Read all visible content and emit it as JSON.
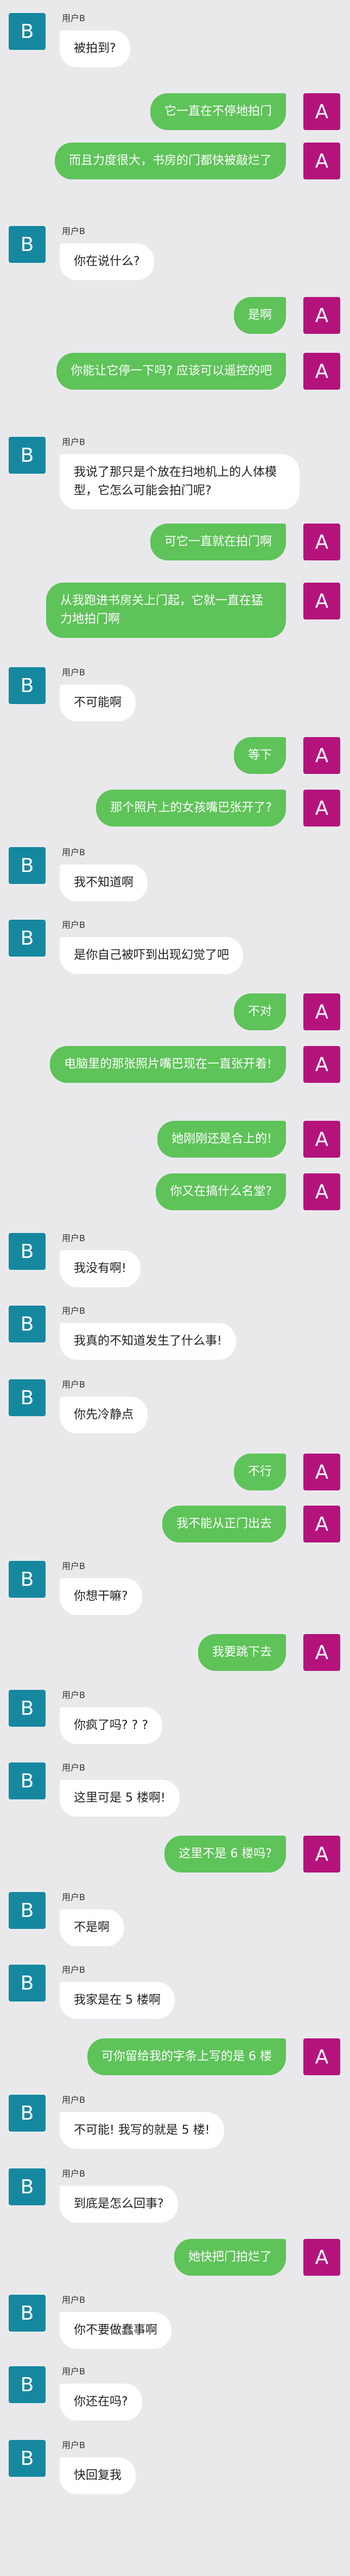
{
  "users": {
    "b_avatar_letter": "B",
    "a_avatar_letter": "A",
    "b_name": "用户B"
  },
  "colors": {
    "background": "#e9e9ec",
    "b_avatar": "#1588a0",
    "a_avatar": "#b5137c",
    "a_bubble": "#5ec359",
    "b_bubble": "#ffffff"
  },
  "messages": [
    {
      "from": "b",
      "text": "被拍到?"
    },
    {
      "from": "a",
      "text": "它一直在不停地拍门"
    },
    {
      "from": "a",
      "text": "而且力度很大，书房的门都快被敲烂了"
    },
    {
      "from": "b",
      "text": "你在说什么?"
    },
    {
      "from": "a",
      "text": "是啊"
    },
    {
      "from": "a",
      "text": "你能让它停一下吗? 应该可以遥控的吧"
    },
    {
      "from": "b",
      "text": "我说了那只是个放在扫地机上的人体模型，它怎么可能会拍门呢?"
    },
    {
      "from": "a",
      "text": "可它一直就在拍门啊"
    },
    {
      "from": "a",
      "text": "从我跑进书房关上门起，它就一直在猛力地拍门啊"
    },
    {
      "from": "b",
      "text": "不可能啊"
    },
    {
      "from": "a",
      "text": "等下"
    },
    {
      "from": "a",
      "text": "那个照片上的女孩嘴巴张开了?"
    },
    {
      "from": "b",
      "text": "我不知道啊"
    },
    {
      "from": "b",
      "text": "是你自己被吓到出现幻觉了吧"
    },
    {
      "from": "a",
      "text": "不对"
    },
    {
      "from": "a",
      "text": "电脑里的那张照片嘴巴现在一直张开着!"
    },
    {
      "from": "a",
      "text": "她刚刚还是合上的!"
    },
    {
      "from": "a",
      "text": "你又在搞什么名堂?"
    },
    {
      "from": "b",
      "text": "我没有啊!"
    },
    {
      "from": "b",
      "text": "我真的不知道发生了什么事!"
    },
    {
      "from": "b",
      "text": "你先冷静点"
    },
    {
      "from": "a",
      "text": "不行"
    },
    {
      "from": "a",
      "text": "我不能从正门出去"
    },
    {
      "from": "b",
      "text": "你想干嘛?"
    },
    {
      "from": "a",
      "text": "我要跳下去"
    },
    {
      "from": "b",
      "text": "你疯了吗? ? ?"
    },
    {
      "from": "b",
      "text": "这里可是 5 楼啊!"
    },
    {
      "from": "a",
      "text": "这里不是 6 楼吗?"
    },
    {
      "from": "b",
      "text": "不是啊"
    },
    {
      "from": "b",
      "text": "我家是在 5 楼啊"
    },
    {
      "from": "a",
      "text": "可你留给我的字条上写的是 6 楼"
    },
    {
      "from": "b",
      "text": "不可能! 我写的就是 5 楼!"
    },
    {
      "from": "b",
      "text": "到底是怎么回事?"
    },
    {
      "from": "a",
      "text": "她快把门拍烂了"
    },
    {
      "from": "b",
      "text": "你不要做蠢事啊"
    },
    {
      "from": "b",
      "text": "你还在吗?"
    },
    {
      "from": "b",
      "text": "快回复我"
    }
  ]
}
